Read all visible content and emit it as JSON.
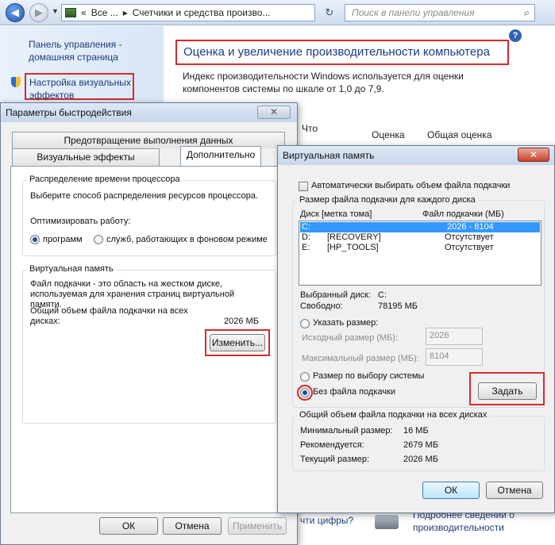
{
  "explorer": {
    "address": {
      "overflow": "«",
      "crumb1": "Все ...",
      "crumb2": "Счетчики и средства произво..."
    },
    "search_placeholder": "Поиск в панели управления",
    "help_symbol": "?",
    "left_links": {
      "home": "Панель управления - домашняя страница",
      "visual": "Настройка визуальных эффектов"
    },
    "title": "Оценка и увеличение производительности компьютера",
    "intro": "Индекс производительности Windows используется для оценки компонентов системы по шкале от 1,0 до 7,9.",
    "columns": {
      "component": "Что",
      "rating": "Оценка",
      "overall": "Общая оценка"
    },
    "bottom_link": "чти цифры?",
    "bottom_link2": "Подробнее сведений о производительности"
  },
  "perf_dialog": {
    "title": "Параметры быстродействия",
    "close_symbol": "✕",
    "tabs": {
      "dep": "Предотвращение выполнения данных",
      "visual": "Визуальные эффекты",
      "advanced": "Дополнительно"
    },
    "cpu_group": {
      "label": "Распределение времени процессора",
      "desc": "Выберите способ распределения ресурсов процессора.",
      "optimize_label": "Оптимизировать работу:",
      "opt_programs": "программ",
      "opt_services": "служб, работающих в фоновом режиме"
    },
    "vm_group": {
      "label": "Виртуальная память",
      "desc": "Файл подкачки - это область на жестком диске, используемая для хранения страниц виртуальной памяти.",
      "total_label": "Общий объем файла подкачки на всех дисках:",
      "total_value": "2026 МБ",
      "change_button": "Изменить..."
    },
    "buttons": {
      "ok": "ОК",
      "cancel": "Отмена",
      "apply": "Применить"
    }
  },
  "vm_dialog": {
    "title": "Виртуальная память",
    "close_symbol": "✕",
    "auto_checkbox": "Автоматически выбирать объем файла подкачки",
    "per_drive_label": "Размер файла подкачки для каждого диска",
    "list_headers": {
      "drive": "Диск [метка тома]",
      "file": "Файл подкачки (МБ)"
    },
    "drives": [
      {
        "drive": "C:",
        "label": "",
        "size": "2026 - 8104"
      },
      {
        "drive": "D:",
        "label": "[RECOVERY]",
        "size": "Отсутствует"
      },
      {
        "drive": "E:",
        "label": "[HP_TOOLS]",
        "size": "Отсутствует"
      }
    ],
    "selected_drive_label": "Выбранный диск:",
    "selected_drive_value": "C:",
    "free_label": "Свободно:",
    "free_value": "78195 МБ",
    "custom_size": "Указать размер:",
    "initial_label": "Исходный размер (МБ):",
    "initial_value": "2026",
    "max_label": "Максимальный размер (МБ):",
    "max_value": "8104",
    "system_managed": "Размер по выбору системы",
    "no_paging": "Без файла подкачки",
    "set_button": "Задать",
    "totals_label": "Общий объем файла подкачки на всех дисках",
    "min_label": "Минимальный размер:",
    "min_value": "16 МБ",
    "rec_label": "Рекомендуется:",
    "rec_value": "2679 МБ",
    "cur_label": "Текущий размер:",
    "cur_value": "2026 МБ",
    "buttons": {
      "ok": "ОК",
      "cancel": "Отмена"
    }
  },
  "colors": {
    "highlight_red": "#d42b2b",
    "selection_blue": "#3399ff",
    "link_blue": "#1c3b7a"
  }
}
